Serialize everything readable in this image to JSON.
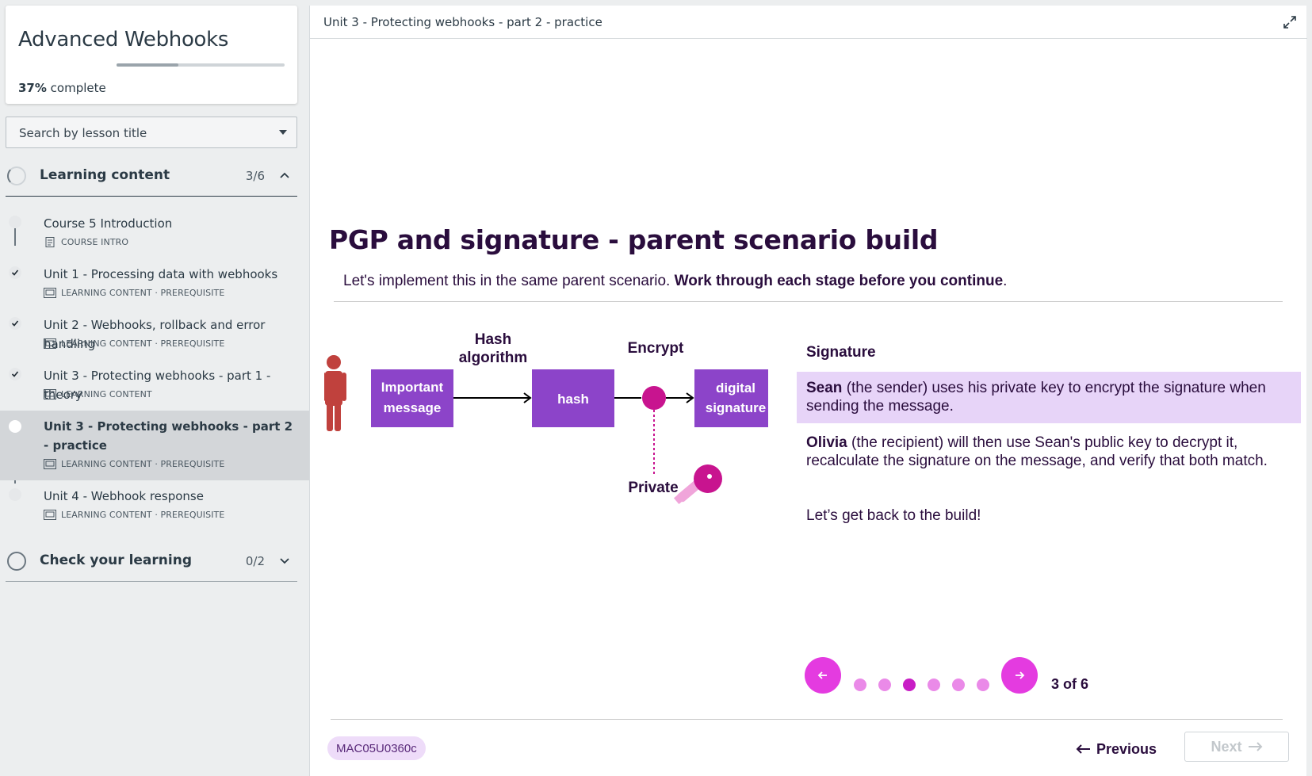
{
  "sidebar": {
    "course_title": "Advanced Webhooks",
    "progress_percent": "37%",
    "progress_fraction": 0.37,
    "progress_suffix": " complete",
    "search_placeholder": "Search by lesson title",
    "sections": [
      {
        "title": "Learning content",
        "count": "3/6",
        "expanded": true
      },
      {
        "title": "Check your learning",
        "count": "0/2",
        "expanded": false
      }
    ],
    "lessons": [
      {
        "title": "Course 5 Introduction",
        "meta": "COURSE INTRO",
        "status": "not-started",
        "icon": "document-icon"
      },
      {
        "title": "Unit 1 - Processing data with webhooks",
        "meta": "LEARNING CONTENT · PREREQUISITE",
        "status": "complete",
        "icon": "slides-icon"
      },
      {
        "title": "Unit 2 - Webhooks, rollback and error handling",
        "meta": "LEARNING CONTENT · PREREQUISITE",
        "status": "complete",
        "icon": "slides-icon"
      },
      {
        "title": "Unit 3 - Protecting webhooks - part 1 - theory",
        "meta": "LEARNING CONTENT",
        "status": "complete",
        "icon": "slides-icon"
      },
      {
        "title": "Unit 3 - Protecting webhooks - part 2 - practice",
        "meta": "LEARNING CONTENT · PREREQUISITE",
        "status": "current",
        "icon": "slides-icon"
      },
      {
        "title": "Unit 4 - Webhook response",
        "meta": "LEARNING CONTENT · PREREQUISITE",
        "status": "not-started",
        "icon": "slides-icon"
      }
    ]
  },
  "main": {
    "topbar_title": "Unit 3 - Protecting webhooks - part 2 - practice",
    "slide_title": "PGP and signature - parent scenario build",
    "lead_text": "Let's implement this in the same parent scenario. ",
    "lead_bold": "Work through each stage before you continue",
    "lead_end": ".",
    "diagram": {
      "label_hash_1": "Hash",
      "label_hash_2": "algorithm",
      "label_encrypt": "Encrypt",
      "label_private": "Private",
      "box_message_1": "Important",
      "box_message_2": "message",
      "box_hash": "hash",
      "box_signature_1": "digital",
      "box_signature_2": "signature"
    },
    "signature_heading": "Signature",
    "para1_bold": "Sean",
    "para1_text": " (the sender) uses his private key to encrypt the signature when sending the message.",
    "para2_bold": "Olivia",
    "para2_text": " (the recipient) will then use Sean's public key to decrypt it, recalculate the signature on the message, and verify that both match.",
    "para3_text": "Let’s get back to the build!",
    "carousel_counter": "3 of 6",
    "carousel_total": 6,
    "carousel_current": 3,
    "code_badge": "MAC05U0360c",
    "previous_label": "Previous",
    "next_label": "Next"
  },
  "colors": {
    "accent_pink": "#e43be0",
    "diagram_purple": "#8c44c9",
    "highlight": "#e7d4f8",
    "person_red": "#c0413d",
    "key_magenta": "#c8148f"
  }
}
